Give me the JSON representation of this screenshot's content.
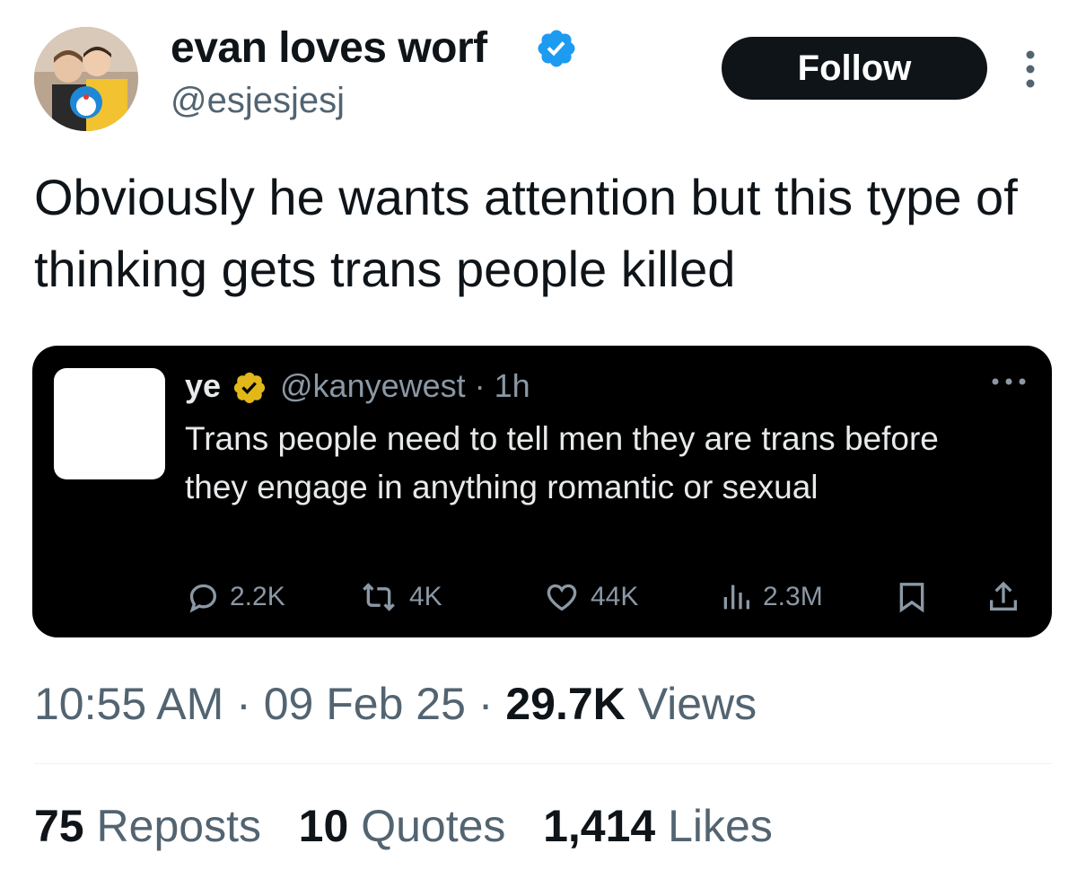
{
  "author": {
    "display_name": "evan loves worf",
    "handle": "@esjesjesj",
    "verified_icon": "verified-badge-icon",
    "verified_color": "#1d9bf0"
  },
  "follow_label": "Follow",
  "tweet_text": "Obviously he wants attention but this type of thinking gets trans people killed",
  "quote": {
    "name": "ye",
    "badge_color": "#e2b719",
    "handle_time": "@kanyewest · 1h",
    "text": "Trans people need to tell men they are trans before they engage in anything romantic or sexual",
    "actions": {
      "replies": "2.2K",
      "reposts": "4K",
      "likes": "44K",
      "views": "2.3M"
    }
  },
  "meta": {
    "time": "10:55 AM",
    "date": "09 Feb 25",
    "views_count": "29.7K",
    "views_label": "Views"
  },
  "stats": {
    "reposts_count": "75",
    "reposts_label": "Reposts",
    "quotes_count": "10",
    "quotes_label": "Quotes",
    "likes_count": "1,414",
    "likes_label": "Likes"
  }
}
